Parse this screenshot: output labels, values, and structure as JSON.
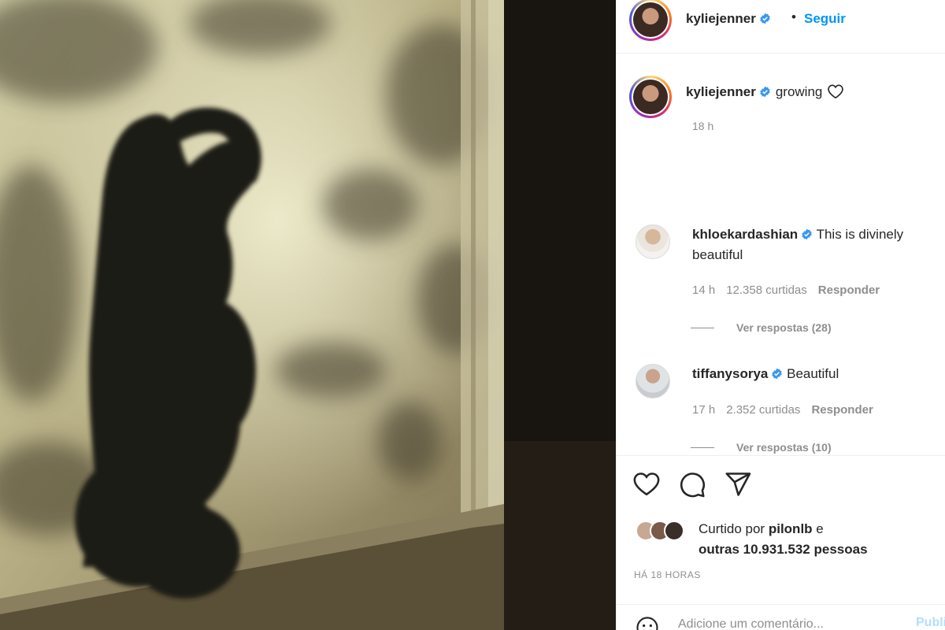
{
  "post": {
    "author": "kyliejenner",
    "follow_label": "Seguir",
    "separator": "•",
    "caption": "growing",
    "caption_time": "18 h"
  },
  "comments": [
    {
      "user": "khloekardashian",
      "text": "This is divinely beautiful",
      "time": "14 h",
      "likes": "12.358 curtidas",
      "reply_label": "Responder",
      "view_replies": "Ver respostas (28)"
    },
    {
      "user": "tiffanysorya",
      "text": "Beautiful",
      "time": "17 h",
      "likes": "2.352 curtidas",
      "reply_label": "Responder",
      "view_replies": "Ver respostas (10)"
    }
  ],
  "actions": {
    "like_icon": "heart-icon",
    "comment_icon": "comment-icon",
    "share_icon": "send-icon",
    "liked_by_prefix": "Curtido por",
    "liked_by_user": "pilonlb",
    "liked_by_joiner": "e",
    "liked_by_others": "outras 10.931.532 pessoas",
    "time_ago": "HÁ 18 HORAS"
  },
  "comment_box": {
    "placeholder": "Adicione um comentário...",
    "publish_label": "Publicar",
    "emoji_icon": "smile-icon"
  },
  "colors": {
    "accent": "#0095f6",
    "verified": "#3897f0",
    "muted": "#8e8e8e",
    "publish_disabled": "#b2dffc"
  }
}
